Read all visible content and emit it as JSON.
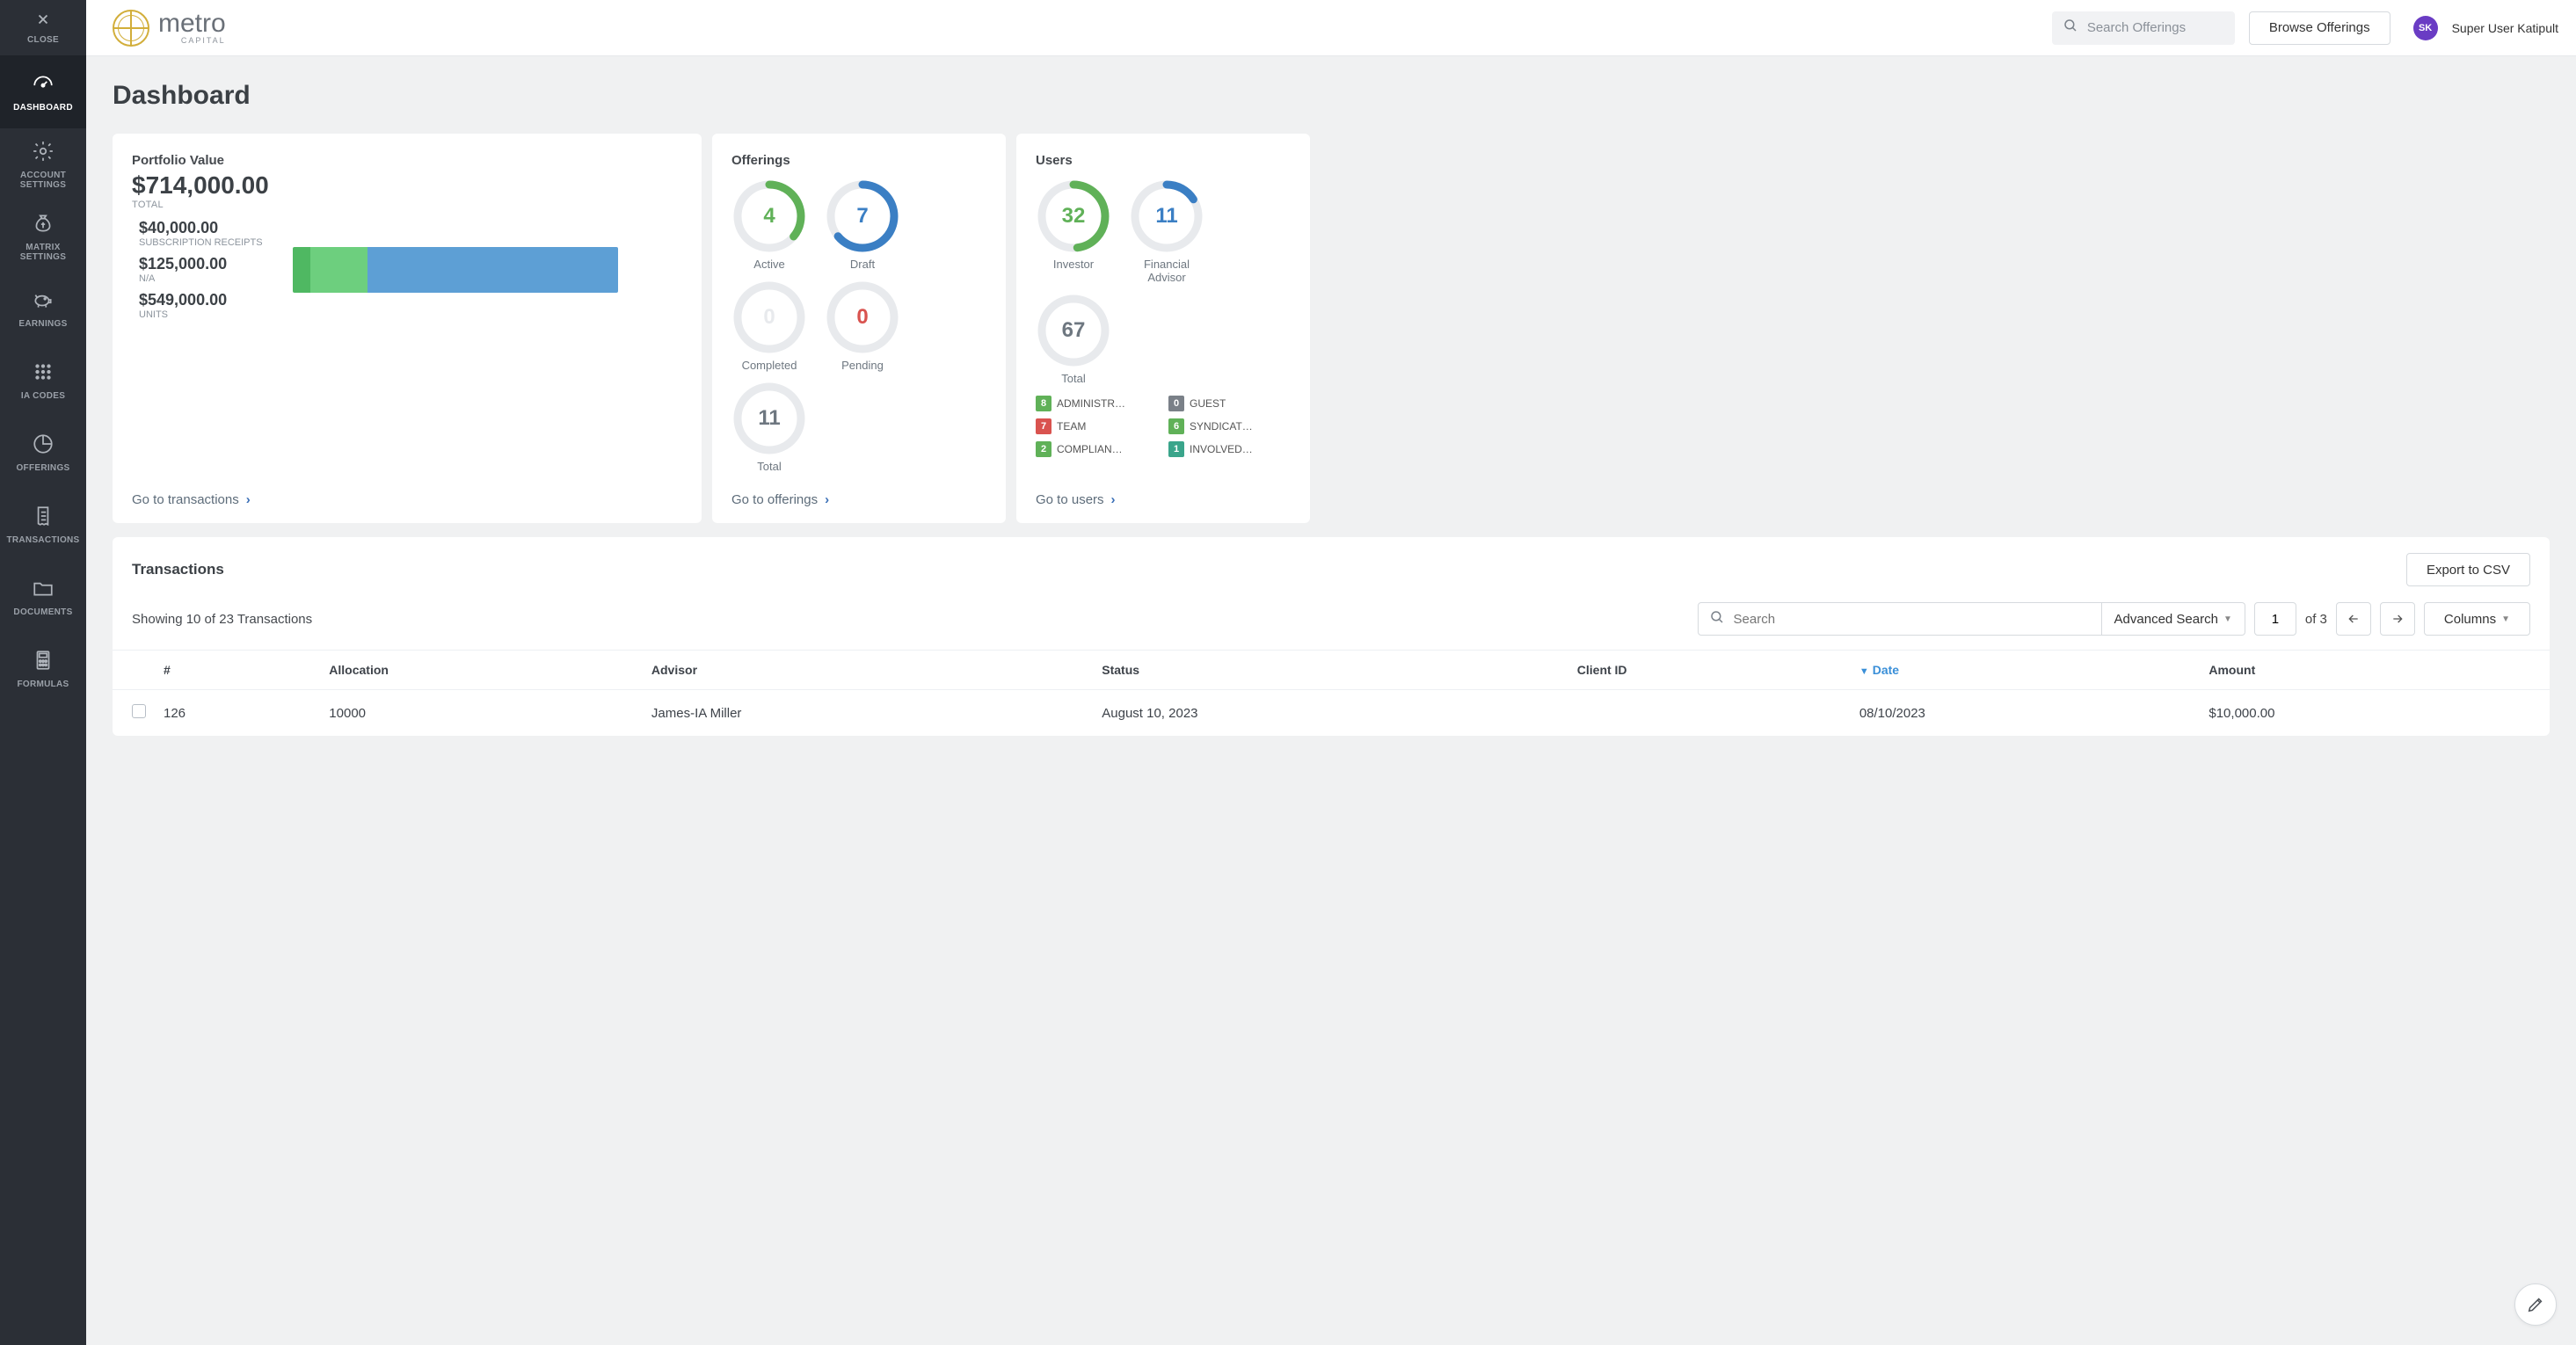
{
  "sidebar": {
    "close": "CLOSE",
    "items": [
      {
        "label": "DASHBOARD",
        "active": true
      },
      {
        "label": "ACCOUNT SETTINGS"
      },
      {
        "label": "MATRIX SETTINGS"
      },
      {
        "label": "EARNINGS"
      },
      {
        "label": "IA CODES"
      },
      {
        "label": "OFFERINGS"
      },
      {
        "label": "TRANSACTIONS"
      },
      {
        "label": "DOCUMENTS"
      },
      {
        "label": "FORMULAS"
      }
    ]
  },
  "topbar": {
    "brand": "metro",
    "sub": "CAPITAL",
    "search_placeholder": "Search Offerings",
    "browse": "Browse Offerings",
    "avatar": "SK",
    "user": "Super User Katipult"
  },
  "page_title": "Dashboard",
  "portfolio": {
    "title": "Portfolio Value",
    "total": "$714,000.00",
    "total_label": "TOTAL",
    "items": [
      {
        "amt": "$40,000.00",
        "lab": "SUBSCRIPTION RECEIPTS"
      },
      {
        "amt": "$125,000.00",
        "lab": "N/A"
      },
      {
        "amt": "$549,000.00",
        "lab": "UNITS"
      }
    ],
    "link": "Go to transactions"
  },
  "offerings": {
    "title": "Offerings",
    "gauges": [
      {
        "value": "4",
        "label": "Active",
        "color": "#60b158",
        "frac": 0.36
      },
      {
        "value": "7",
        "label": "Draft",
        "color": "#3b7fc4",
        "frac": 0.64
      },
      {
        "value": "0",
        "label": "Completed",
        "color": "#e8eaed",
        "frac": 0
      },
      {
        "value": "0",
        "label": "Pending",
        "color": "#d9534f",
        "frac": 0,
        "valColor": "#d9534f"
      },
      {
        "value": "11",
        "label": "Total",
        "color": "#e8eaed",
        "frac": 0,
        "valColor": "#6e7780"
      }
    ],
    "link": "Go to offerings"
  },
  "users": {
    "title": "Users",
    "gauges": [
      {
        "value": "32",
        "label": "Investor",
        "color": "#60b158",
        "frac": 0.48
      },
      {
        "value": "11",
        "label": "Financial Advisor",
        "color": "#3b7fc4",
        "frac": 0.16
      },
      {
        "value": "67",
        "label": "Total",
        "color": "#e8eaed",
        "frac": 0,
        "valColor": "#6e7780"
      }
    ],
    "badges": [
      {
        "n": "8",
        "c": "green",
        "l": "ADMINISTR…"
      },
      {
        "n": "0",
        "c": "grey",
        "l": "GUEST"
      },
      {
        "n": "7",
        "c": "red",
        "l": "TEAM"
      },
      {
        "n": "6",
        "c": "green",
        "l": "SYNDICAT…"
      },
      {
        "n": "2",
        "c": "green",
        "l": "COMPLIAN…"
      },
      {
        "n": "1",
        "c": "teal",
        "l": "INVOLVED…"
      }
    ],
    "link": "Go to users"
  },
  "tx": {
    "title": "Transactions",
    "export": "Export to CSV",
    "showing": "Showing 10 of 23 Transactions",
    "search_placeholder": "Search",
    "advanced": "Advanced Search",
    "page": "1",
    "of": "of 3",
    "columns": "Columns",
    "headers": {
      "num": "#",
      "allocation": "Allocation",
      "advisor": "Advisor",
      "status": "Status",
      "client": "Client ID",
      "date": "Date",
      "amount": "Amount"
    },
    "rows": [
      {
        "num": "126",
        "allocation": "10000",
        "advisor": "James-IA Miller",
        "status": "August 10, 2023",
        "client": "",
        "date": "08/10/2023",
        "amount": "$10,000.00"
      }
    ]
  },
  "chart_data": {
    "type": "bar",
    "title": "Portfolio Value breakdown",
    "categories": [
      "Subscription Receipts",
      "N/A",
      "Units"
    ],
    "values": [
      40000,
      125000,
      549000
    ],
    "total": 714000,
    "colors": [
      "#4fb862",
      "#6dcf7e",
      "#5d9fd5"
    ]
  }
}
